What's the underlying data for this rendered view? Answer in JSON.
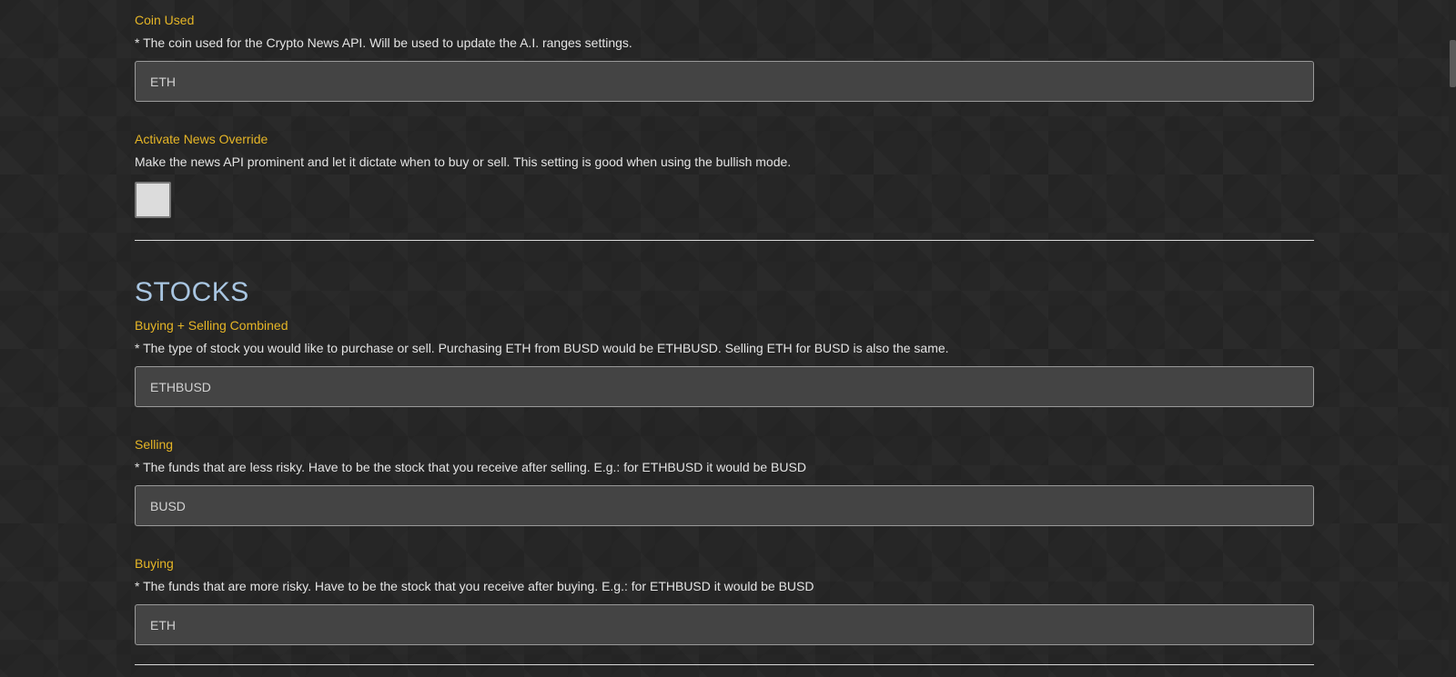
{
  "crypto_news": {
    "coin_used": {
      "label": "Coin Used",
      "description": "* The coin used for the Crypto News API. Will be used to update the A.I. ranges settings.",
      "value": "ETH"
    },
    "news_override": {
      "label": "Activate News Override",
      "description": "Make the news API prominent and let it dictate when to buy or sell. This setting is good when using the bullish mode.",
      "checked": false
    }
  },
  "stocks": {
    "title": "STOCKS",
    "combined": {
      "label": "Buying + Selling Combined",
      "description": "* The type of stock you would like to purchase or sell. Purchasing ETH from BUSD would be ETHBUSD. Selling ETH for BUSD is also the same.",
      "value": "ETHBUSD"
    },
    "selling": {
      "label": "Selling",
      "description": "* The funds that are less risky. Have to be the stock that you receive after selling. E.g.: for ETHBUSD it would be BUSD",
      "value": "BUSD"
    },
    "buying": {
      "label": "Buying",
      "description": "* The funds that are more risky. Have to be the stock that you receive after buying. E.g.: for ETHBUSD it would be BUSD",
      "value": "ETH"
    }
  },
  "colors": {
    "label": "#e5b526",
    "section_title": "#a9c6e2",
    "background": "#262626",
    "input_bg": "#444444"
  }
}
